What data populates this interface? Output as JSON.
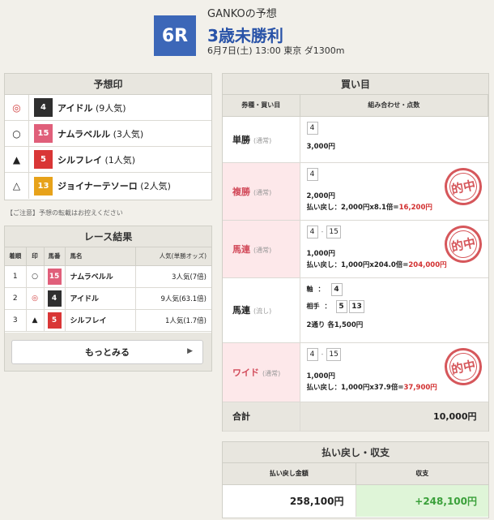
{
  "header": {
    "forecaster": "GANKOの予想",
    "race_no": "6R",
    "race_name": "3歳未勝利",
    "race_info": "6月7日(土) 13:00 東京 ダ1300m"
  },
  "prediction": {
    "title": "予想印",
    "rows": [
      {
        "mark": "◎",
        "num": "4",
        "horse": "アイドル",
        "pop": "(9人気)"
      },
      {
        "mark": "○",
        "num": "15",
        "horse": "ナムラベルル",
        "pop": "(3人気)"
      },
      {
        "mark": "▲",
        "num": "5",
        "horse": "シルフレイ",
        "pop": "(1人気)"
      },
      {
        "mark": "△",
        "num": "13",
        "horse": "ジョイナーテソーロ",
        "pop": "(2人気)"
      }
    ],
    "note": "【ご注意】予想の転載はお控えください"
  },
  "results": {
    "title": "レース結果",
    "headers": [
      "着順",
      "印",
      "馬番",
      "馬名",
      "人気(単勝オッズ)"
    ],
    "rows": [
      {
        "rank": "1",
        "mark": "○",
        "num": "15",
        "horse": "ナムラベルル",
        "pop": "3人気(7倍)"
      },
      {
        "rank": "2",
        "mark": "◎",
        "num": "4",
        "horse": "アイドル",
        "pop": "9人気(63.1倍)"
      },
      {
        "rank": "3",
        "mark": "▲",
        "num": "5",
        "horse": "シルフレイ",
        "pop": "1人気(1.7倍)"
      }
    ],
    "more_label": "もっとみる"
  },
  "bets": {
    "title": "買い目",
    "headers": [
      "券種・買い目",
      "組み合わせ・点数"
    ],
    "tansho": {
      "type": "単勝",
      "sub": "(通常)",
      "n1": "4",
      "amount": "3,000円"
    },
    "fukusho": {
      "type": "複勝",
      "sub": "(通常)",
      "n1": "4",
      "amount": "2,000円",
      "payout_label": "払い戻し：2,000円x8.1倍=",
      "payout_value": "16,200円"
    },
    "umaren": {
      "type": "馬連",
      "sub": "(通常)",
      "n1": "4",
      "n2": "15",
      "amount": "1,000円",
      "payout_label": "払い戻し：1,000円x204.0倍=",
      "payout_value": "204,000円"
    },
    "umaren_nagashi": {
      "type": "馬連",
      "sub": "(流し)",
      "axis_label": "軸",
      "axis": "4",
      "partner_label": "相手",
      "p1": "5",
      "p2": "13",
      "amount": "2通り 各1,500円"
    },
    "wide": {
      "type": "ワイド",
      "sub": "(通常)",
      "n1": "4",
      "n2": "15",
      "amount": "1,000円",
      "payout_label": "払い戻し：1,000円x37.9倍=",
      "payout_value": "37,900円"
    },
    "stamp": "的中",
    "total_label": "合計",
    "total_value": "10,000円"
  },
  "summary": {
    "title": "払い戻し・収支",
    "headers": [
      "払い戻し金額",
      "収支"
    ],
    "payout": "258,100円",
    "profit": "+248,100円"
  }
}
